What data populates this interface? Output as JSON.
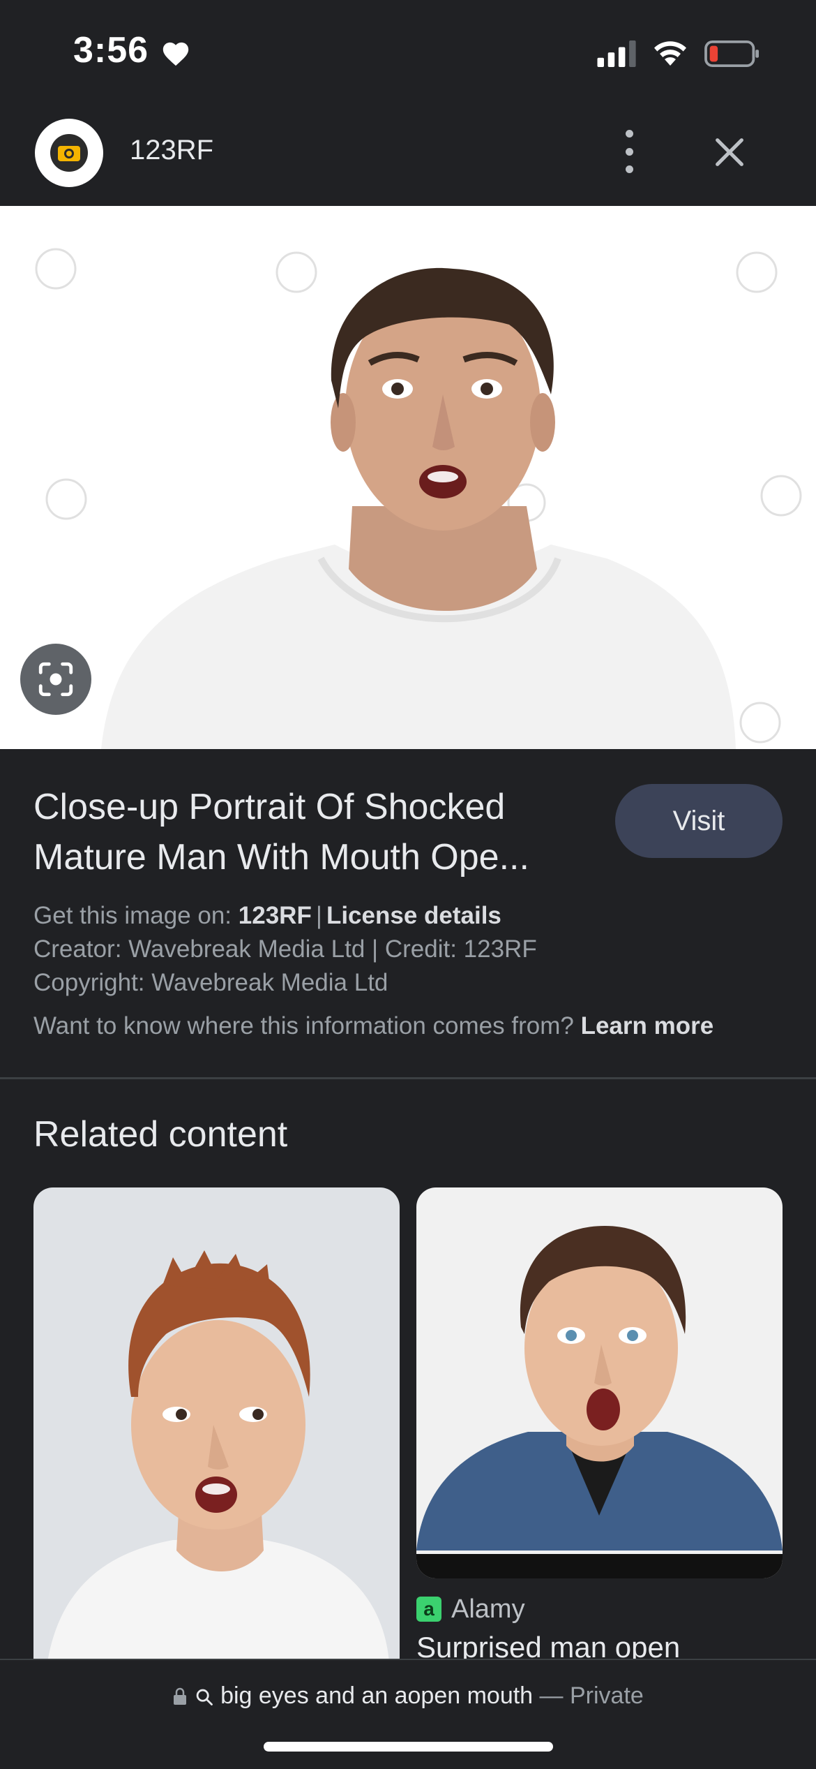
{
  "status_bar": {
    "time": "3:56"
  },
  "header": {
    "site_name": "123RF"
  },
  "result": {
    "title": "Close-up Portrait Of Shocked Mature Man With Mouth Ope...",
    "visit_label": "Visit",
    "get_image_prefix": "Get this image on:",
    "get_image_source": "123RF",
    "license_label": "License details",
    "creator_line": "Creator: Wavebreak Media Ltd | Credit: 123RF",
    "copyright_line": "Copyright: Wavebreak Media Ltd",
    "info_question": "Want to know where this information comes from?",
    "learn_more": "Learn more"
  },
  "related": {
    "heading": "Related content",
    "cards": [
      {
        "source": "",
        "title": ""
      },
      {
        "source": "Alamy",
        "badge": "a",
        "title": "Surprised man open"
      }
    ]
  },
  "bottom_bar": {
    "query": "big eyes and an aopen mouth",
    "dash": "—",
    "mode": "Private"
  },
  "colors": {
    "background": "#202124",
    "visit_button": "#3c4358",
    "alamy_green": "#3bd16f"
  }
}
